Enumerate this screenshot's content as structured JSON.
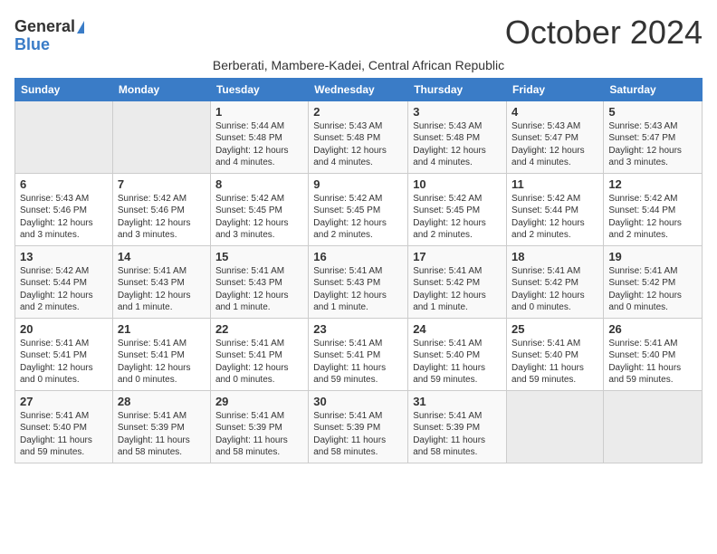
{
  "logo": {
    "general": "General",
    "blue": "Blue"
  },
  "title": "October 2024",
  "subtitle": "Berberati, Mambere-Kadei, Central African Republic",
  "weekdays": [
    "Sunday",
    "Monday",
    "Tuesday",
    "Wednesday",
    "Thursday",
    "Friday",
    "Saturday"
  ],
  "weeks": [
    [
      {
        "day": "",
        "info": ""
      },
      {
        "day": "",
        "info": ""
      },
      {
        "day": "1",
        "info": "Sunrise: 5:44 AM\nSunset: 5:48 PM\nDaylight: 12 hours\nand 4 minutes."
      },
      {
        "day": "2",
        "info": "Sunrise: 5:43 AM\nSunset: 5:48 PM\nDaylight: 12 hours\nand 4 minutes."
      },
      {
        "day": "3",
        "info": "Sunrise: 5:43 AM\nSunset: 5:48 PM\nDaylight: 12 hours\nand 4 minutes."
      },
      {
        "day": "4",
        "info": "Sunrise: 5:43 AM\nSunset: 5:47 PM\nDaylight: 12 hours\nand 4 minutes."
      },
      {
        "day": "5",
        "info": "Sunrise: 5:43 AM\nSunset: 5:47 PM\nDaylight: 12 hours\nand 3 minutes."
      }
    ],
    [
      {
        "day": "6",
        "info": "Sunrise: 5:43 AM\nSunset: 5:46 PM\nDaylight: 12 hours\nand 3 minutes."
      },
      {
        "day": "7",
        "info": "Sunrise: 5:42 AM\nSunset: 5:46 PM\nDaylight: 12 hours\nand 3 minutes."
      },
      {
        "day": "8",
        "info": "Sunrise: 5:42 AM\nSunset: 5:45 PM\nDaylight: 12 hours\nand 3 minutes."
      },
      {
        "day": "9",
        "info": "Sunrise: 5:42 AM\nSunset: 5:45 PM\nDaylight: 12 hours\nand 2 minutes."
      },
      {
        "day": "10",
        "info": "Sunrise: 5:42 AM\nSunset: 5:45 PM\nDaylight: 12 hours\nand 2 minutes."
      },
      {
        "day": "11",
        "info": "Sunrise: 5:42 AM\nSunset: 5:44 PM\nDaylight: 12 hours\nand 2 minutes."
      },
      {
        "day": "12",
        "info": "Sunrise: 5:42 AM\nSunset: 5:44 PM\nDaylight: 12 hours\nand 2 minutes."
      }
    ],
    [
      {
        "day": "13",
        "info": "Sunrise: 5:42 AM\nSunset: 5:44 PM\nDaylight: 12 hours\nand 2 minutes."
      },
      {
        "day": "14",
        "info": "Sunrise: 5:41 AM\nSunset: 5:43 PM\nDaylight: 12 hours\nand 1 minute."
      },
      {
        "day": "15",
        "info": "Sunrise: 5:41 AM\nSunset: 5:43 PM\nDaylight: 12 hours\nand 1 minute."
      },
      {
        "day": "16",
        "info": "Sunrise: 5:41 AM\nSunset: 5:43 PM\nDaylight: 12 hours\nand 1 minute."
      },
      {
        "day": "17",
        "info": "Sunrise: 5:41 AM\nSunset: 5:42 PM\nDaylight: 12 hours\nand 1 minute."
      },
      {
        "day": "18",
        "info": "Sunrise: 5:41 AM\nSunset: 5:42 PM\nDaylight: 12 hours\nand 0 minutes."
      },
      {
        "day": "19",
        "info": "Sunrise: 5:41 AM\nSunset: 5:42 PM\nDaylight: 12 hours\nand 0 minutes."
      }
    ],
    [
      {
        "day": "20",
        "info": "Sunrise: 5:41 AM\nSunset: 5:41 PM\nDaylight: 12 hours\nand 0 minutes."
      },
      {
        "day": "21",
        "info": "Sunrise: 5:41 AM\nSunset: 5:41 PM\nDaylight: 12 hours\nand 0 minutes."
      },
      {
        "day": "22",
        "info": "Sunrise: 5:41 AM\nSunset: 5:41 PM\nDaylight: 12 hours\nand 0 minutes."
      },
      {
        "day": "23",
        "info": "Sunrise: 5:41 AM\nSunset: 5:41 PM\nDaylight: 11 hours\nand 59 minutes."
      },
      {
        "day": "24",
        "info": "Sunrise: 5:41 AM\nSunset: 5:40 PM\nDaylight: 11 hours\nand 59 minutes."
      },
      {
        "day": "25",
        "info": "Sunrise: 5:41 AM\nSunset: 5:40 PM\nDaylight: 11 hours\nand 59 minutes."
      },
      {
        "day": "26",
        "info": "Sunrise: 5:41 AM\nSunset: 5:40 PM\nDaylight: 11 hours\nand 59 minutes."
      }
    ],
    [
      {
        "day": "27",
        "info": "Sunrise: 5:41 AM\nSunset: 5:40 PM\nDaylight: 11 hours\nand 59 minutes."
      },
      {
        "day": "28",
        "info": "Sunrise: 5:41 AM\nSunset: 5:39 PM\nDaylight: 11 hours\nand 58 minutes."
      },
      {
        "day": "29",
        "info": "Sunrise: 5:41 AM\nSunset: 5:39 PM\nDaylight: 11 hours\nand 58 minutes."
      },
      {
        "day": "30",
        "info": "Sunrise: 5:41 AM\nSunset: 5:39 PM\nDaylight: 11 hours\nand 58 minutes."
      },
      {
        "day": "31",
        "info": "Sunrise: 5:41 AM\nSunset: 5:39 PM\nDaylight: 11 hours\nand 58 minutes."
      },
      {
        "day": "",
        "info": ""
      },
      {
        "day": "",
        "info": ""
      }
    ]
  ]
}
